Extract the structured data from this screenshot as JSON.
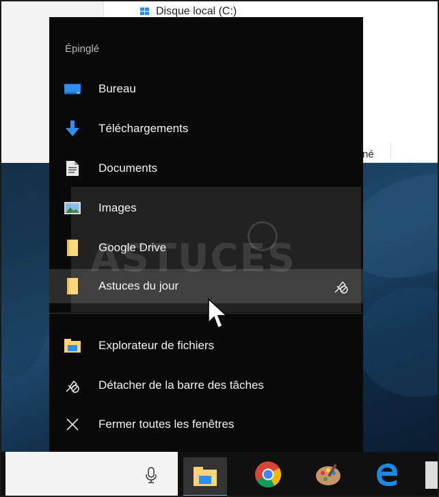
{
  "explorer": {
    "drive_label": "Disque local (C:)",
    "partial_text": "né"
  },
  "jump_list": {
    "section_title": "Épinglé",
    "pinned_items": [
      {
        "label": "Bureau",
        "icon": "desktop-folder-icon"
      },
      {
        "label": "Téléchargements",
        "icon": "download-arrow-icon"
      },
      {
        "label": "Documents",
        "icon": "document-icon"
      },
      {
        "label": "Images",
        "icon": "pictures-icon"
      },
      {
        "label": "Google Drive",
        "icon": "folder-icon"
      },
      {
        "label": "Astuces du jour",
        "icon": "folder-icon",
        "unpin_icon": "unpin-icon"
      }
    ],
    "tasks": [
      {
        "label": "Explorateur de fichiers",
        "icon": "file-explorer-icon"
      },
      {
        "label": "Détacher de la barre des tâches",
        "icon": "unpin-icon"
      },
      {
        "label": "Fermer toutes les fenêtres",
        "icon": "close-icon"
      }
    ]
  },
  "watermark": {
    "text": "ASTUCES"
  },
  "taskbar": {
    "apps": [
      "file-explorer-icon",
      "chrome-icon",
      "paint-icon",
      "edge-icon"
    ]
  },
  "colors": {
    "menu_bg": "#0a0a0a",
    "hover_bg": "#2b2b2b",
    "accent_blue": "#2f8ff0",
    "folder_yellow": "#f8d574",
    "text": "#f2f2f2"
  }
}
